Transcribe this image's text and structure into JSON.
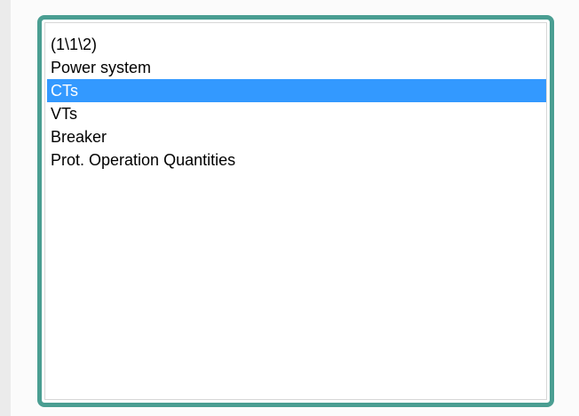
{
  "listbox": {
    "selected_index": 2,
    "items": [
      {
        "label": "(1\\1\\2)"
      },
      {
        "label": "Power system"
      },
      {
        "label": "CTs"
      },
      {
        "label": "VTs"
      },
      {
        "label": "Breaker"
      },
      {
        "label": "Prot. Operation Quantities"
      }
    ]
  },
  "colors": {
    "frame_border": "#4a9e92",
    "selection_background": "#3399ff",
    "selection_text": "#ffffff",
    "item_text": "#000000"
  }
}
